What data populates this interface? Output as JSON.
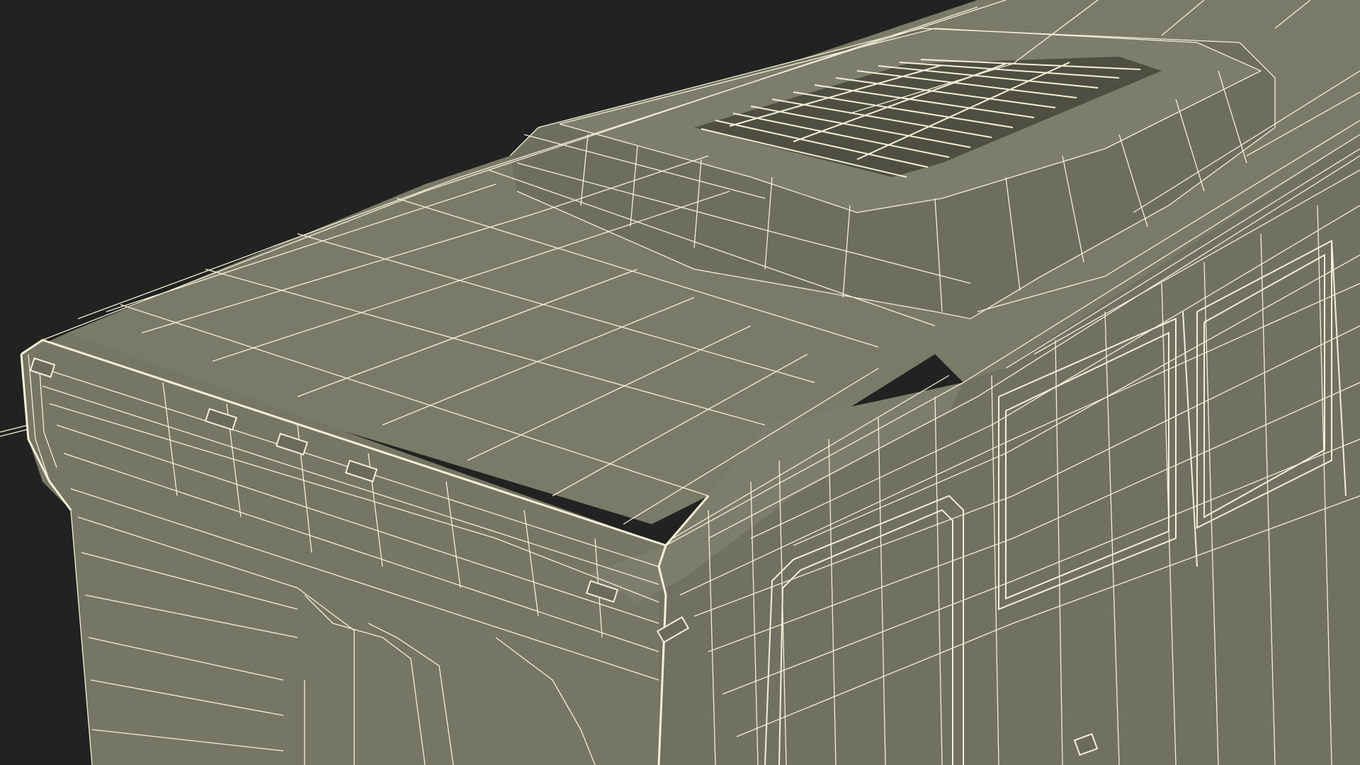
{
  "viewport": {
    "background_color": "#222222",
    "model_face_color": "#7a7a68",
    "model_face_dark_color": "#6f7060",
    "model_face_light_color": "#85857a",
    "wire_color": "#f2f0d8",
    "subject": "wireframe-box-vehicle-body"
  }
}
